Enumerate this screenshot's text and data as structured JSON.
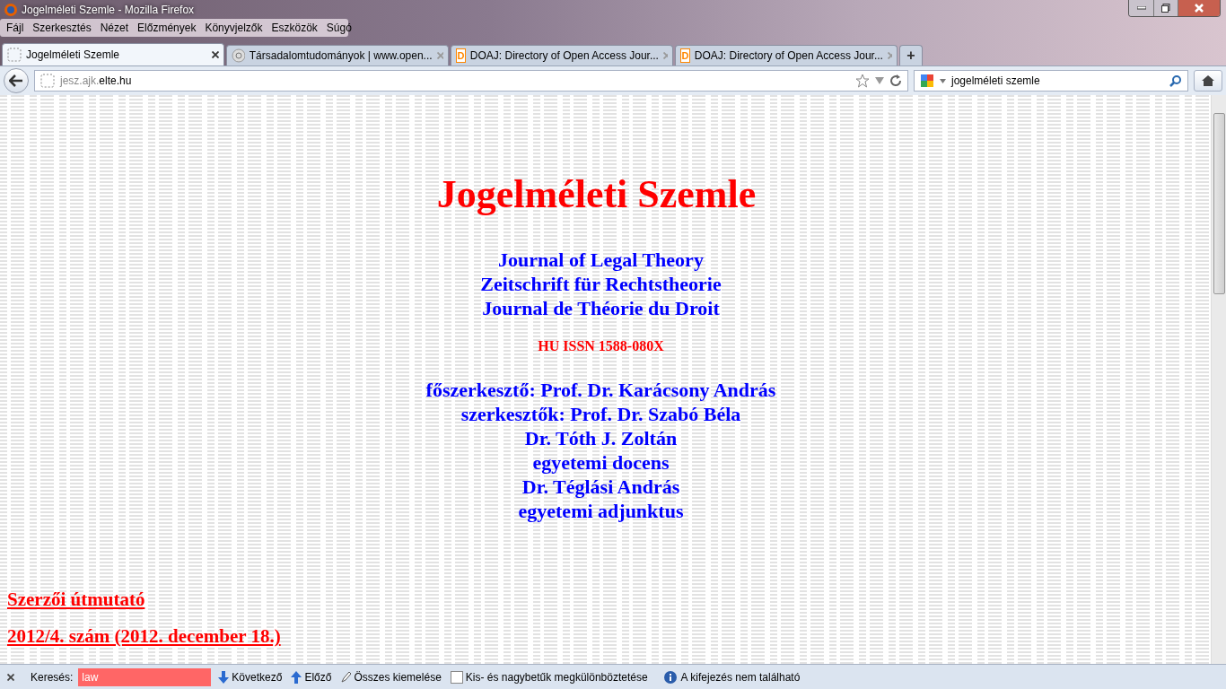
{
  "window": {
    "title": "Jogelméleti Szemle - Mozilla Firefox"
  },
  "menu": [
    "Fájl",
    "Szerkesztés",
    "Nézet",
    "Előzmények",
    "Könyvjelzők",
    "Eszközök",
    "Súgó"
  ],
  "tabs": [
    {
      "label": "Jogelméleti Szemle",
      "selected": true,
      "kind": "blank"
    },
    {
      "label": "Társadalomtudományok | www.open...",
      "selected": false,
      "kind": "at"
    },
    {
      "label": "DOAJ: Directory of Open Access Jour...",
      "selected": false,
      "kind": "doaj",
      "icon_letter": "D"
    },
    {
      "label": "DOAJ: Directory of Open Access Jour...",
      "selected": false,
      "kind": "doaj",
      "icon_letter": "D"
    }
  ],
  "new_tab": "+",
  "address": {
    "host_prefix": "jesz.ajk.",
    "host_domain": "elte.hu"
  },
  "search": {
    "value": "jogelméleti szemle"
  },
  "page": {
    "title": "Jogelméleti Szemle",
    "subtitles": [
      "Journal of Legal Theory",
      "Zeitschrift für Rechtstheorie",
      "Journal de Théorie du Droit"
    ],
    "issn": "HU ISSN 1588-080X",
    "editors": [
      "főszerkesztő: Prof. Dr. Karácsony András",
      "szerkesztők: Prof. Dr. Szabó Béla",
      "Dr. Tóth J. Zoltán",
      "egyetemi docens",
      "Dr. Téglási András",
      "egyetemi adjunktus"
    ],
    "links": [
      "Szerzői útmutató",
      "2012/4. szám (2012. december 18.)"
    ]
  },
  "find_bar": {
    "label": "Keresés:",
    "value": "law",
    "not_found": true,
    "next": "Következő",
    "previous": "Előző",
    "highlight_all": "Összes kiemelése",
    "match_case": {
      "label": "Kis- és nagybetűk megkülönböztetése",
      "checked": false
    },
    "status": "A kifejezés nem található"
  }
}
